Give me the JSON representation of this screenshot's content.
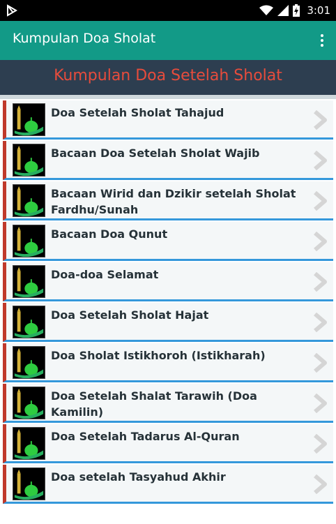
{
  "status_bar": {
    "time": "3:01",
    "left_icon": "play-store-icon",
    "right_icons": [
      "wifi-icon",
      "signal-icon",
      "battery-charging-icon"
    ]
  },
  "app_bar": {
    "title": "Kumpulan Doa Sholat",
    "menu_icon": "overflow-menu-icon"
  },
  "header": {
    "title": "Kumpulan Doa Setelah Sholat"
  },
  "list": {
    "items": [
      {
        "label": "Doa Setelah Sholat Tahajud",
        "icon": "mosque-icon"
      },
      {
        "label": "Bacaan Doa Setelah Sholat Wajib",
        "icon": "mosque-icon"
      },
      {
        "label": "Bacaan Wirid dan Dzikir setelah Sholat Fardhu/Sunah",
        "icon": "mosque-icon"
      },
      {
        "label": "Bacaan Doa Qunut",
        "icon": "mosque-icon"
      },
      {
        "label": "Doa-doa Selamat",
        "icon": "mosque-icon"
      },
      {
        "label": "Doa Setelah Sholat Hajat",
        "icon": "mosque-icon"
      },
      {
        "label": "Doa Sholat Istikhoroh (Istikharah)",
        "icon": "mosque-icon"
      },
      {
        "label": "Doa Setelah Shalat Tarawih (Doa Kamilin)",
        "icon": "mosque-icon"
      },
      {
        "label": "Doa Setelah Tadarus Al-Quran",
        "icon": "mosque-icon"
      },
      {
        "label": "Doa setelah Tasyahud Akhir",
        "icon": "mosque-icon"
      }
    ]
  },
  "colors": {
    "app_bar": "#129a87",
    "header_band": "#2d3e50",
    "header_text": "#e74c3c",
    "item_left_border": "#c0392b",
    "item_bottom_border": "#3498db"
  }
}
